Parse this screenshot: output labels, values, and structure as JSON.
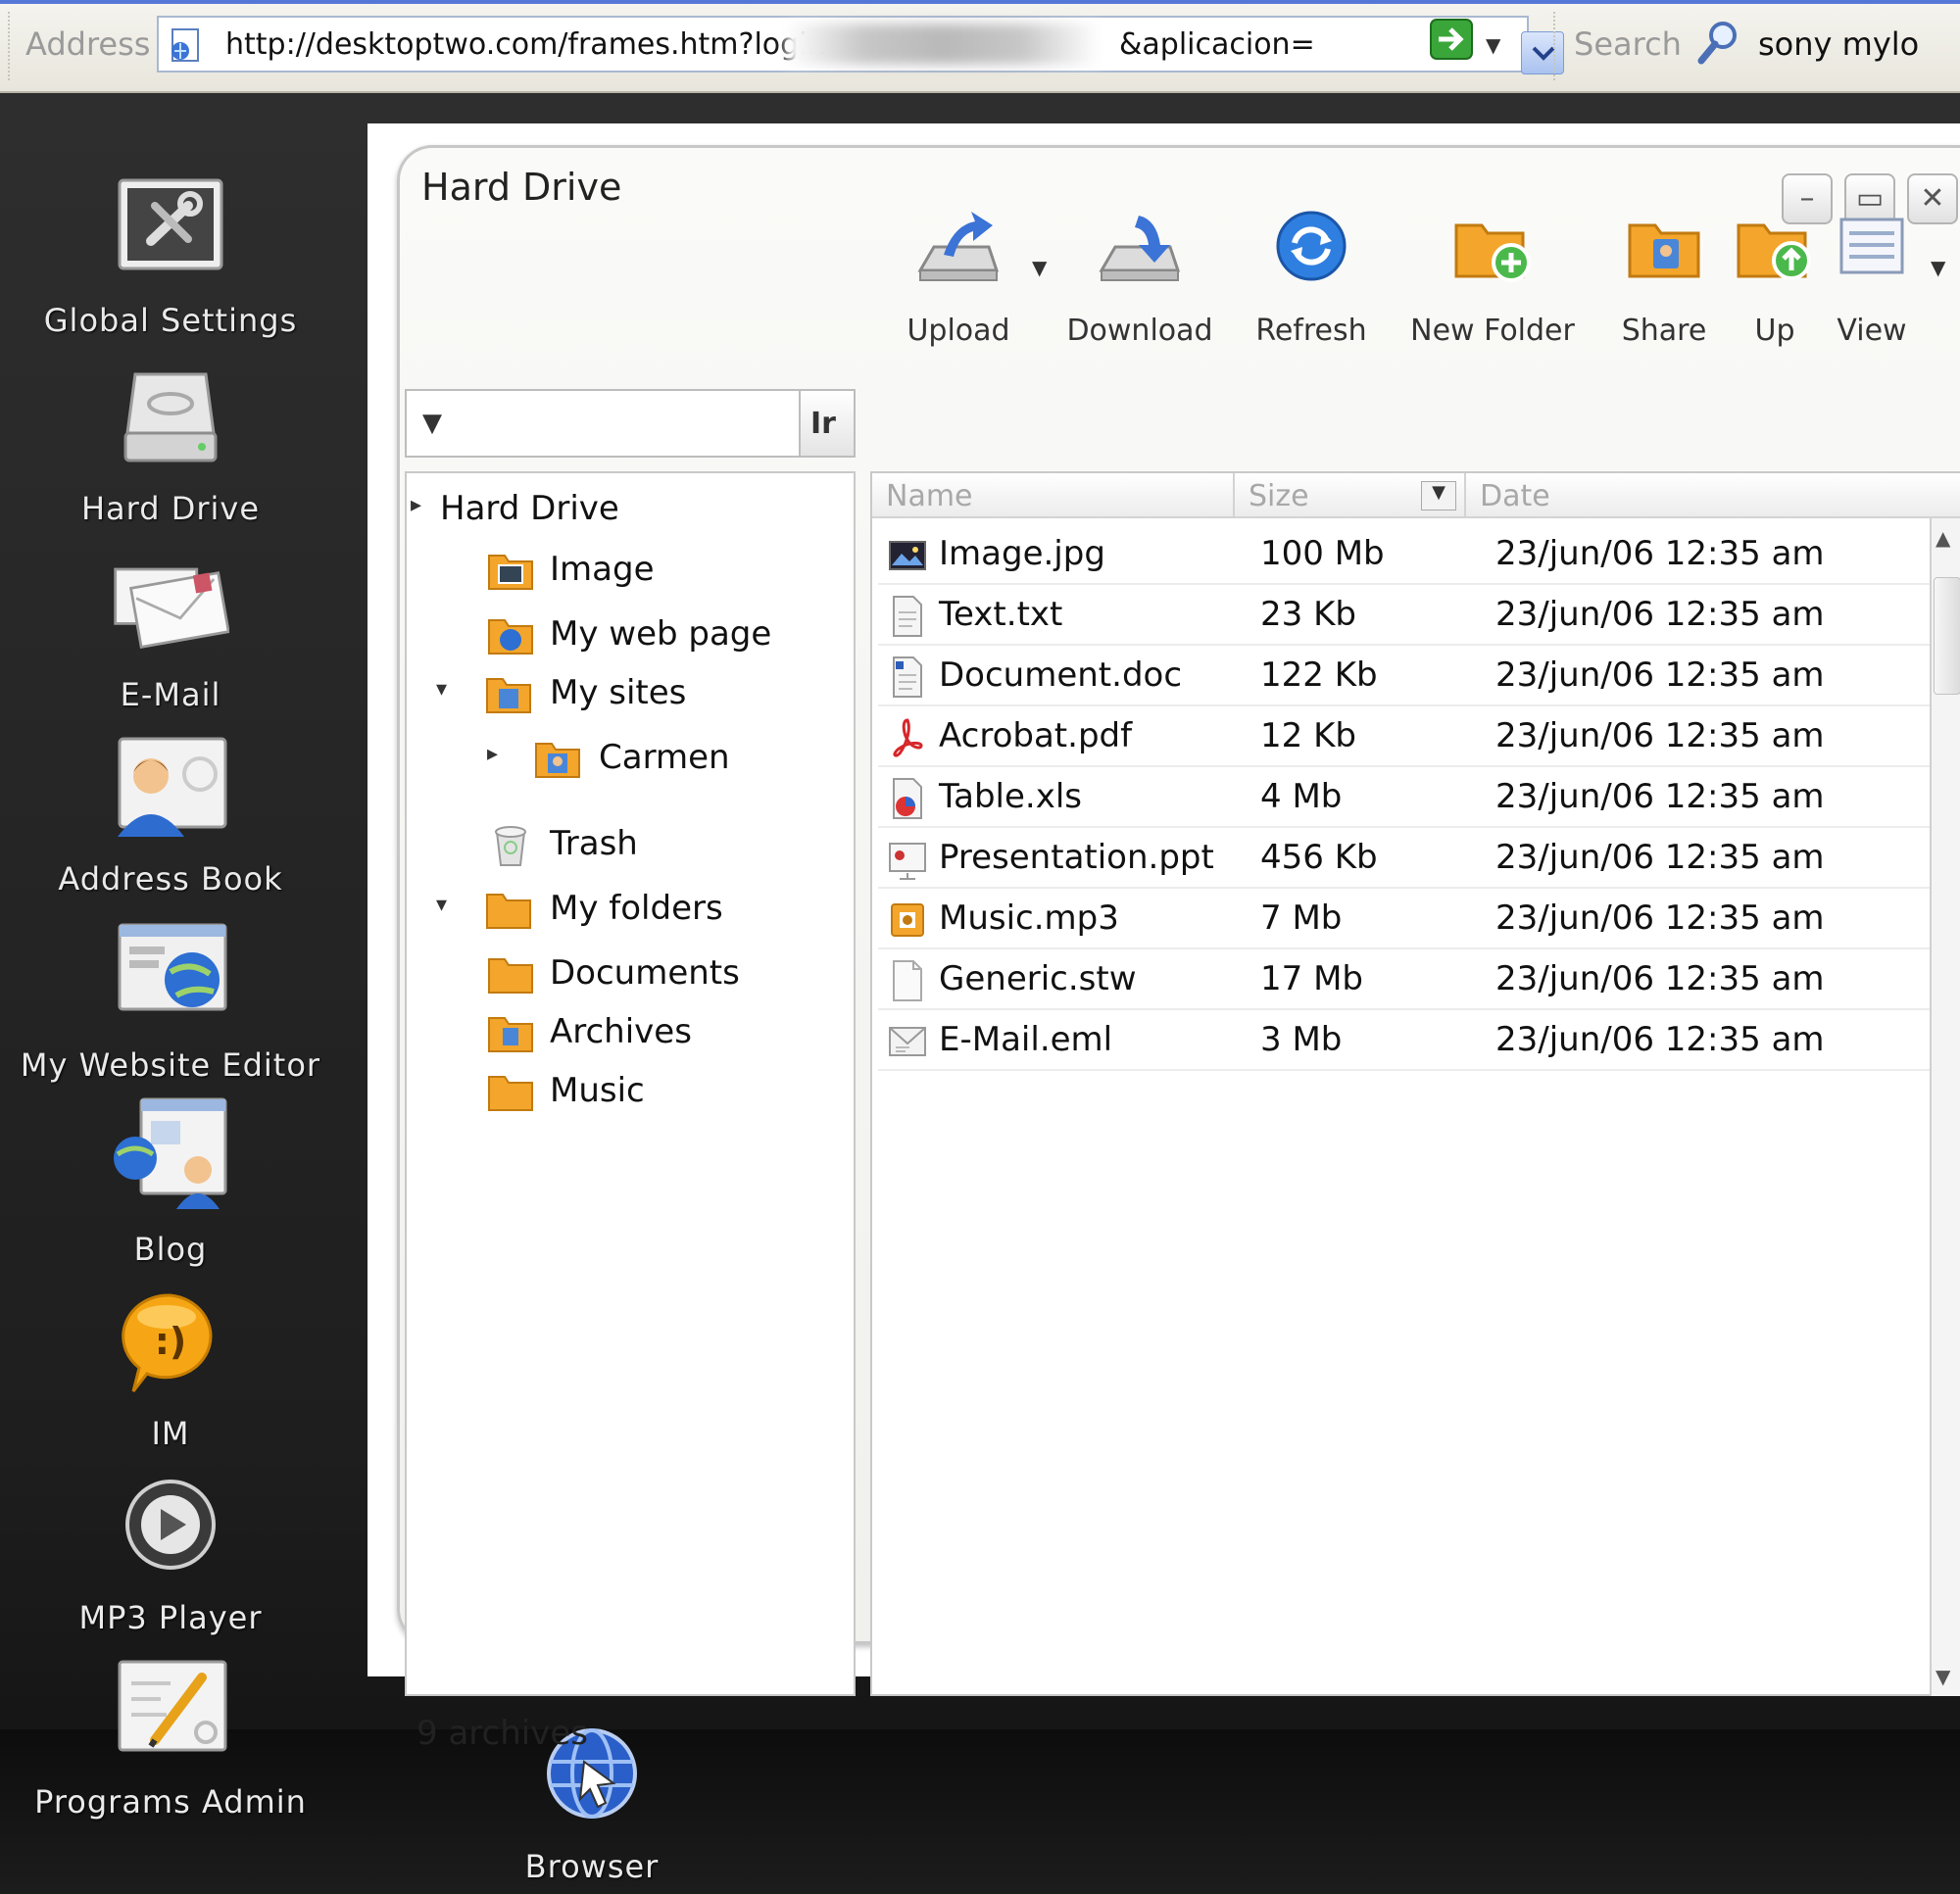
{
  "browser": {
    "address_label": "Address",
    "url_prefix": "http://desktoptwo.com/frames.htm?login=",
    "url_suffix": "&aplicacion=",
    "search_label": "Search",
    "search_value": "sony mylo"
  },
  "desktop_icons": [
    {
      "label": "Global Settings",
      "icon": "settings-icon"
    },
    {
      "label": "Hard Drive",
      "icon": "hard-drive-icon"
    },
    {
      "label": "E-Mail",
      "icon": "email-icon"
    },
    {
      "label": "Address Book",
      "icon": "address-book-icon"
    },
    {
      "label": "My Website Editor",
      "icon": "website-editor-icon"
    },
    {
      "label": "Blog",
      "icon": "blog-icon"
    },
    {
      "label": "IM",
      "icon": "im-icon"
    },
    {
      "label": "MP3 Player",
      "icon": "mp3-player-icon"
    },
    {
      "label": "Programs Admin",
      "icon": "programs-admin-icon"
    }
  ],
  "taskbar": {
    "browser_label": "Browser"
  },
  "window": {
    "title": "Hard Drive",
    "path_go_label": "Ir",
    "toolbar": {
      "upload": "Upload",
      "download": "Download",
      "refresh": "Refresh",
      "new_folder": "New Folder",
      "share": "Share",
      "up": "Up",
      "view": "View"
    },
    "tree": [
      {
        "label": "Hard Drive",
        "expander": "▸"
      },
      {
        "label": "Image",
        "expander": ""
      },
      {
        "label": "My web page",
        "expander": ""
      },
      {
        "label": "My sites",
        "expander": "▾"
      },
      {
        "label": "Carmen",
        "expander": "▸"
      },
      {
        "label": "Trash",
        "expander": ""
      },
      {
        "label": "My folders",
        "expander": "▾"
      },
      {
        "label": "Documents",
        "expander": ""
      },
      {
        "label": "Archives",
        "expander": ""
      },
      {
        "label": "Music",
        "expander": ""
      }
    ],
    "columns": {
      "name": "Name",
      "size": "Size",
      "date": "Date"
    },
    "files": [
      {
        "name": "Image.jpg",
        "size": "100 Mb",
        "date": "23/jun/06  12:35 am",
        "icon": "image-file-icon"
      },
      {
        "name": "Text.txt",
        "size": "23 Kb",
        "date": "23/jun/06  12:35 am",
        "icon": "text-file-icon"
      },
      {
        "name": "Document.doc",
        "size": "122 Kb",
        "date": "23/jun/06  12:35 am",
        "icon": "doc-file-icon"
      },
      {
        "name": "Acrobat.pdf",
        "size": "12 Kb",
        "date": "23/jun/06  12:35 am",
        "icon": "pdf-file-icon"
      },
      {
        "name": "Table.xls",
        "size": "4 Mb",
        "date": "23/jun/06  12:35 am",
        "icon": "xls-file-icon"
      },
      {
        "name": "Presentation.ppt",
        "size": "456 Kb",
        "date": "23/jun/06  12:35 am",
        "icon": "ppt-file-icon"
      },
      {
        "name": "Music.mp3",
        "size": "7 Mb",
        "date": "23/jun/06  12:35 am",
        "icon": "mp3-file-icon"
      },
      {
        "name": "Generic.stw",
        "size": "17 Mb",
        "date": "23/jun/06  12:35 am",
        "icon": "generic-file-icon"
      },
      {
        "name": "E-Mail.eml",
        "size": "3 Mb",
        "date": "23/jun/06  12:35 am",
        "icon": "eml-file-icon"
      }
    ],
    "status": "9 archives"
  }
}
